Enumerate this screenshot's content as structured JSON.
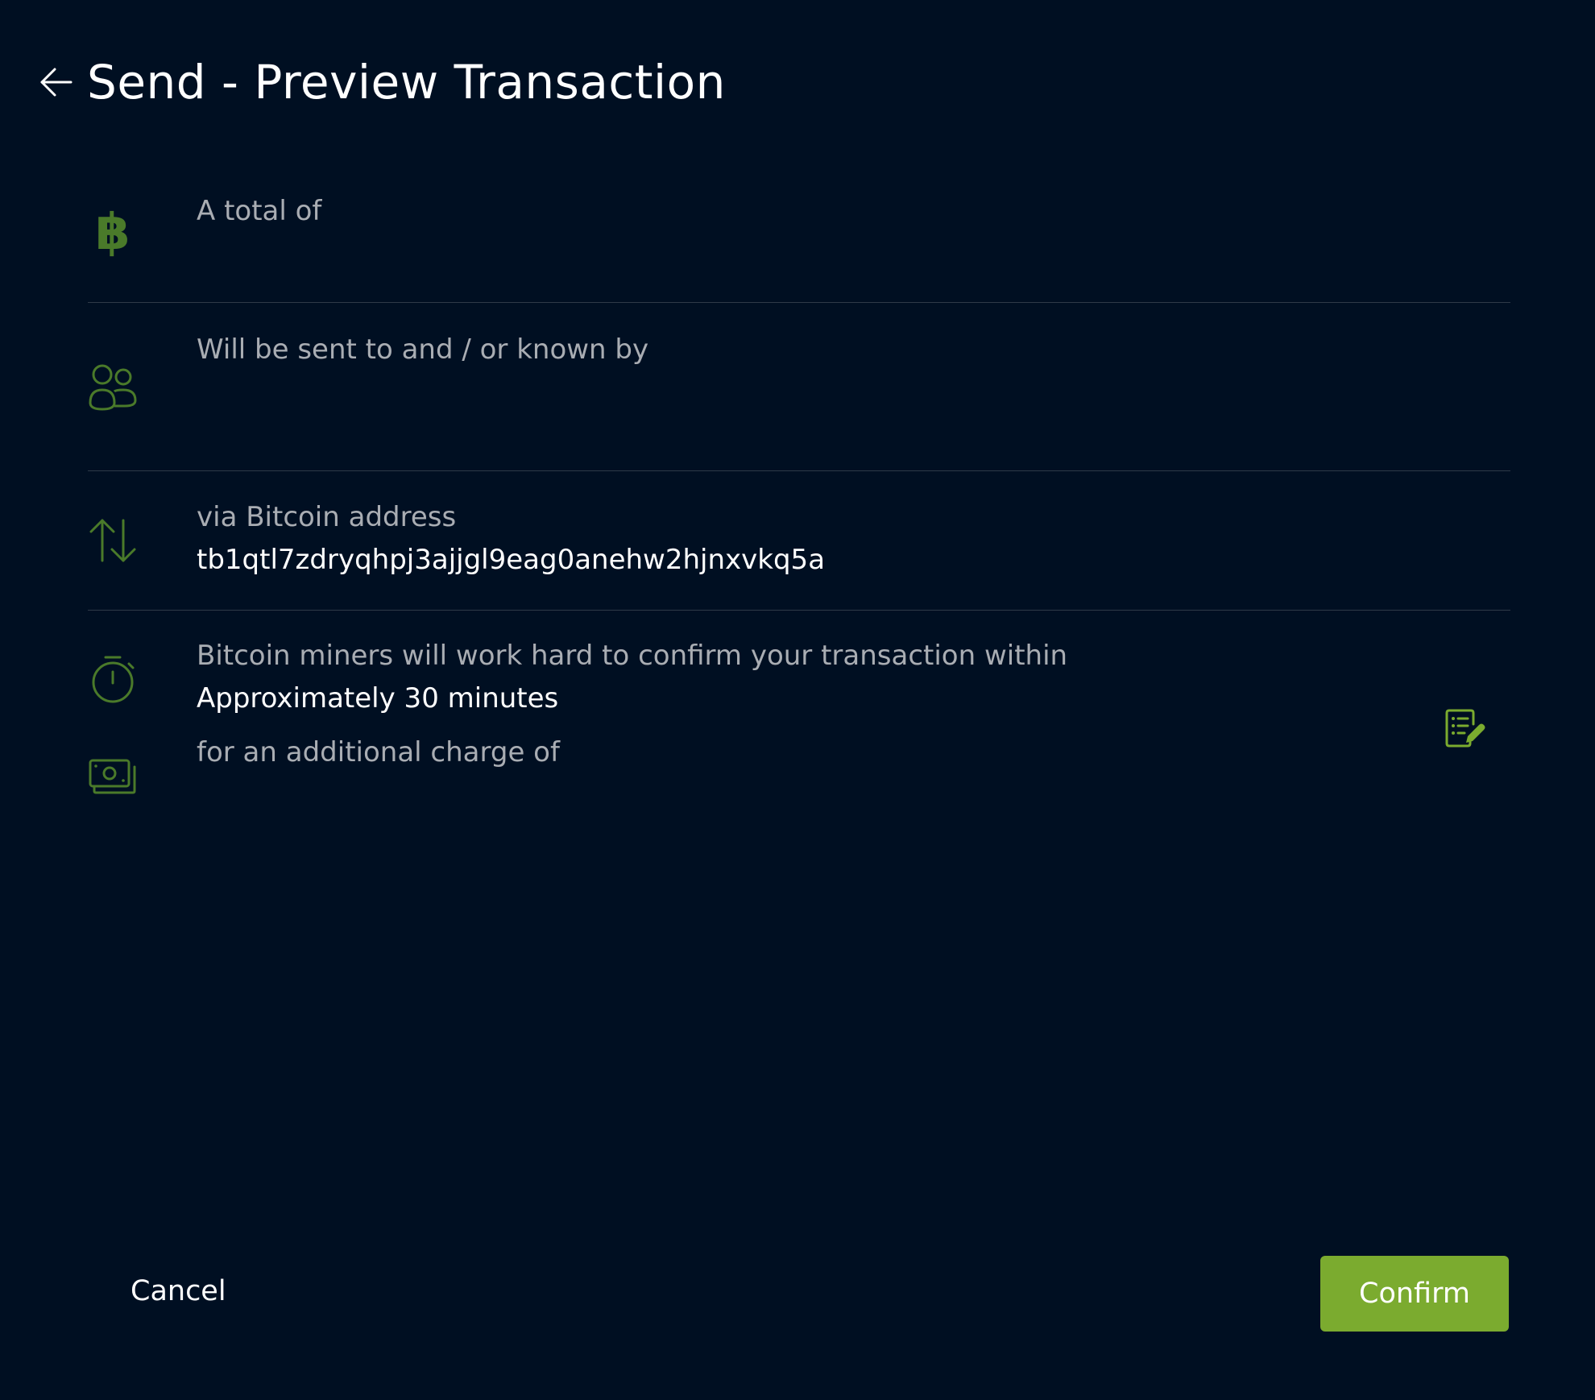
{
  "header": {
    "title": "Send - Preview Transaction",
    "back_icon": "arrow-left-icon"
  },
  "rows": {
    "total": {
      "icon": "bitcoin-icon",
      "label": "A total of",
      "value": ""
    },
    "recipient": {
      "icon": "users-icon",
      "label": "Will be sent to and / or known by",
      "value": ""
    },
    "address": {
      "icon": "arrows-up-down-icon",
      "label": "via Bitcoin address",
      "value": "tb1qtl7zdryqhpj3ajjgl9eag0anehw2hjnxvkq5a"
    },
    "confirmation": {
      "icon": "stopwatch-icon",
      "label": "Bitcoin miners will work hard to confirm your transaction within",
      "value": "Approximately 30 minutes"
    },
    "fee": {
      "icon": "banknotes-icon",
      "label": "for an additional charge of",
      "value": "",
      "edit_icon": "edit-list-icon"
    }
  },
  "footer": {
    "cancel_label": "Cancel",
    "confirm_label": "Confirm"
  },
  "colors": {
    "background": "#000f22",
    "accent": "#7bab2f",
    "icon_green": "#4a7a2a",
    "muted_text": "#a9adb3",
    "divider": "#2f3a48"
  }
}
